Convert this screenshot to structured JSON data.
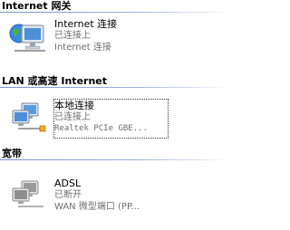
{
  "groups": [
    {
      "title": "Internet 网关",
      "connection": {
        "name": "Internet 连接",
        "status": "已连接上",
        "device": "Internet 连接"
      }
    },
    {
      "title": "LAN 或高速 Internet",
      "connection": {
        "name": "本地连接",
        "status": "已连接上",
        "device": "Realtek PCIe GBE..."
      }
    },
    {
      "title": "宽带",
      "connection": {
        "name": "ADSL",
        "status": "已断开",
        "device": "WAN 微型端口 (PP..."
      }
    }
  ],
  "colors": {
    "header_line": "#7593c6",
    "secondary_text": "#6d6d6d"
  }
}
